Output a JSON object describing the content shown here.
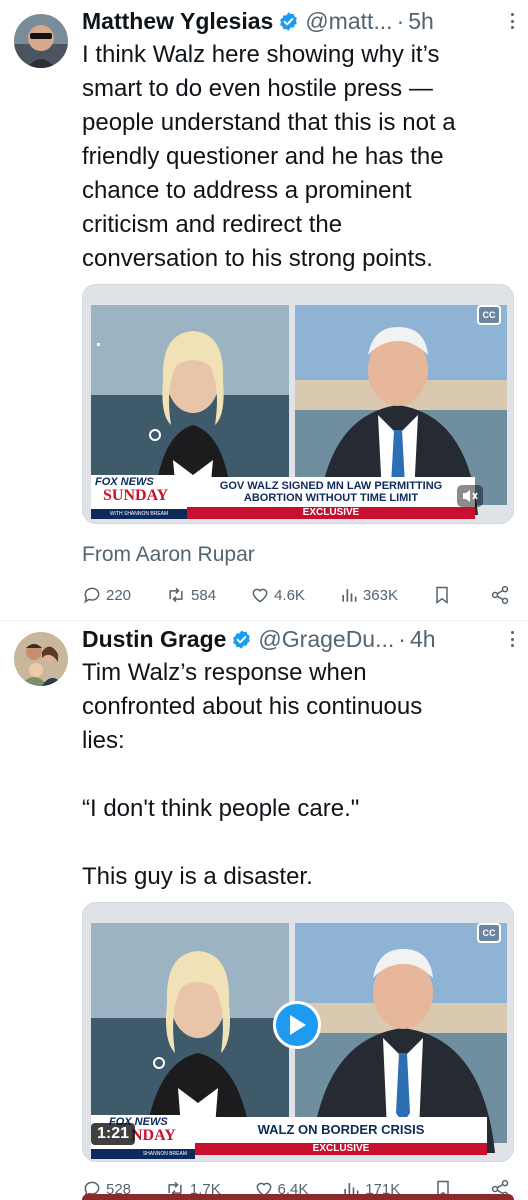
{
  "tweets": [
    {
      "name": "Matthew Yglesias",
      "handle": "@matt...",
      "dot": "·",
      "time": "5h",
      "text": "I think Walz here showing why it’s\nsmart to do even hostile press —\npeople understand that this is not a\nfriendly questioner and he has the\nchance to address a prominent\ncriticism and redirect the\nconversation to his strong points.",
      "media": {
        "network_logo": "FOX NEWS",
        "show": "SUNDAY",
        "host_line": "WITH SHANNON BREAM",
        "headline": "GOV WALZ SIGNED MN LAW PERMITTING\nABORTION WITHOUT TIME LIMIT",
        "tag": "EXCLUSIVE",
        "cc": "CC"
      },
      "from": "From Aaron Rupar",
      "stats": {
        "replies": "220",
        "reposts": "584",
        "likes": "4.6K",
        "views": "363K"
      }
    },
    {
      "name": "Dustin Grage",
      "handle": "@GrageDu...",
      "dot": "·",
      "time": "4h",
      "text": "Tim Walz’s response when\nconfronted about his continuous\nlies:\n\n“I don't think people care.\"\n\nThis guy is a disaster.",
      "media": {
        "network_logo": "FOX NEWS",
        "show": "NDAY",
        "host_line": "SHANNON BREAM",
        "headline": "WALZ ON BORDER CRISIS",
        "tag": "EXCLUSIVE",
        "cc": "CC",
        "duration": "1:21"
      },
      "stats": {
        "replies": "528",
        "reposts": "1.7K",
        "likes": "6.4K",
        "views": "171K"
      }
    }
  ],
  "colors": {
    "text": "#0f1419",
    "secondary": "#536471",
    "verified": "#1d9bf0",
    "fox_red": "#c8102e",
    "fox_navy": "#0d2a5c"
  }
}
